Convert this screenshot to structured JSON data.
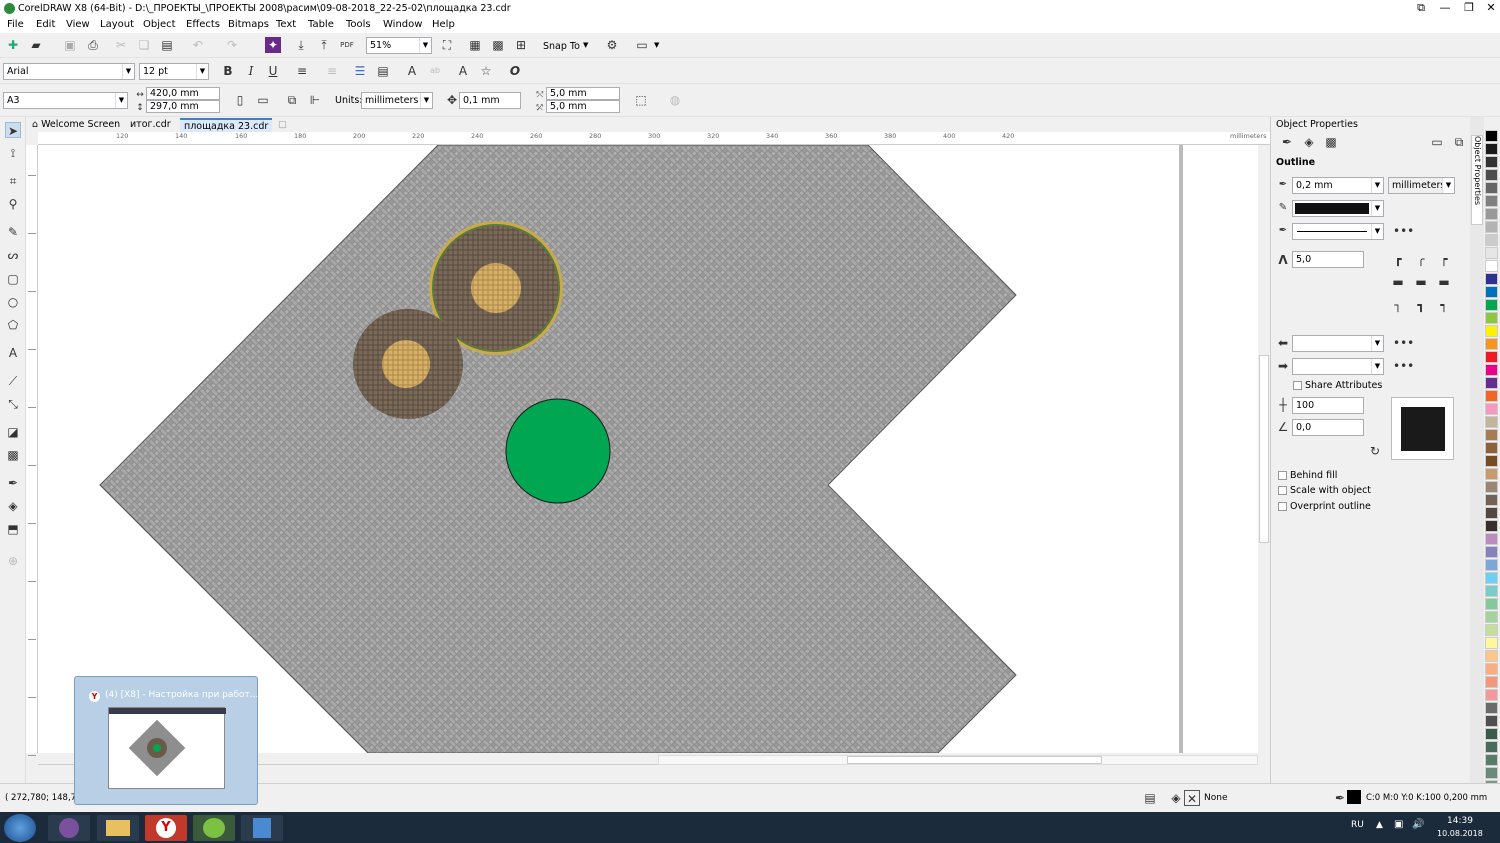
{
  "window": {
    "title": "CorelDRAW X8 (64-Bit) - D:\\_ПРОЕКТЫ_\\ПРОЕКТЫ 2008\\расим\\09-08-2018_22-25-02\\площадка 23.cdr"
  },
  "menu": [
    "File",
    "Edit",
    "View",
    "Layout",
    "Object",
    "Effects",
    "Bitmaps",
    "Text",
    "Table",
    "Tools",
    "Window",
    "Help"
  ],
  "toolbar": {
    "zoom": "51%",
    "snap_label": "Snap To"
  },
  "text_toolbar": {
    "font": "Arial",
    "size": "12 pt"
  },
  "property_bar": {
    "page_size": "A3",
    "width": "420,0 mm",
    "height": "297,0 mm",
    "units_label": "Units:",
    "units": "millimeters",
    "nudge": "0,1 mm",
    "dup_x": "5,0 mm",
    "dup_y": "5,0 mm"
  },
  "tabs": [
    "Welcome Screen",
    "итог.cdr",
    "площадка 23.cdr"
  ],
  "ruler": {
    "h_ticks": [
      "120",
      "140",
      "160",
      "180",
      "200",
      "220",
      "240",
      "260",
      "280",
      "300",
      "320",
      "340",
      "360",
      "380",
      "400",
      "420"
    ],
    "unit": "millimeters"
  },
  "object_properties": {
    "title": "Object Properties",
    "section": "Outline",
    "width": "0,2 mm",
    "units": "millimeters",
    "miter": "5,0",
    "share_attributes": "Share Attributes",
    "stretch": "100",
    "angle": "0,0",
    "behind_fill": "Behind fill",
    "scale_with_object": "Scale with object",
    "overprint_outline": "Overprint outline",
    "outline_color": "#111111"
  },
  "docker_tab": "Object Properties",
  "palette": [
    "#000000",
    "#1a1a1a",
    "#333333",
    "#4d4d4d",
    "#666666",
    "#808080",
    "#999999",
    "#b3b3b3",
    "#cccccc",
    "#e6e6e6",
    "#ffffff",
    "#2e3192",
    "#0072bc",
    "#00a651",
    "#8dc63f",
    "#fff200",
    "#f7941d",
    "#ed1c24",
    "#ec008c",
    "#662d91",
    "#f26522",
    "#f49ac1",
    "#c2b59b",
    "#a67c52",
    "#8c6239",
    "#754c24",
    "#c69c6d",
    "#998675",
    "#736357",
    "#534741",
    "#362f2d",
    "#bd8cbf",
    "#8781bd",
    "#7da7d9",
    "#6dcff6",
    "#7accc8",
    "#82ca9c",
    "#a3d39c",
    "#c4df9b",
    "#fff799",
    "#fdc689",
    "#f9ad81",
    "#f69679",
    "#f5989d",
    "#6b6b6b",
    "#505050",
    "#3a5a4a",
    "#4a6a5a",
    "#5a7a6a",
    "#6a8a7a",
    "#7a9a8a",
    "#8aaa9a",
    "#9abaa0",
    "#aac8b0"
  ],
  "status": {
    "coords": "( 272,780; 148,758 )",
    "fill": "None",
    "outline": "C:0 M:0 Y:0 K:100  0,200 mm"
  },
  "popup": {
    "title": "(4) [X8] - Настройка при работ..."
  },
  "taskbar": {
    "lang": "RU",
    "time": "14:39",
    "date": "10.08.2018"
  },
  "canvas": {
    "shape_fill": "#8e8e8e",
    "circle_green": "#00a651"
  }
}
